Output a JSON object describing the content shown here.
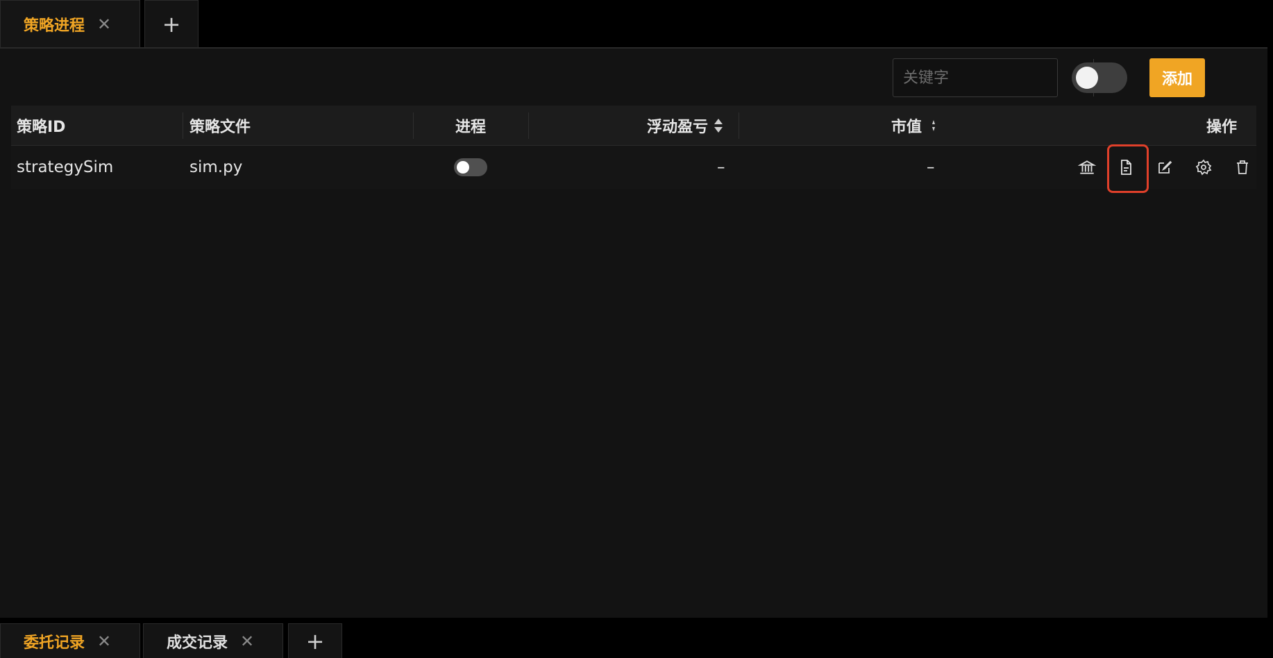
{
  "top_tabs": [
    {
      "label": "策略进程",
      "close": "✕"
    }
  ],
  "add_tab_symbol": "+",
  "toolbar": {
    "search_placeholder": "关键字",
    "add_label": "添加",
    "toggle_on": false
  },
  "table": {
    "headers": {
      "strategy_id": "策略ID",
      "strategy_file": "策略文件",
      "process": "进程",
      "floating_pnl": "浮动盈亏",
      "market_value": "市值",
      "operations": "操作"
    },
    "rows": [
      {
        "strategy_id": "strategySim",
        "strategy_file": "sim.py",
        "process_on": false,
        "floating_pnl": "–",
        "market_value": "–"
      }
    ],
    "row_actions": [
      "bank-icon",
      "document-icon",
      "edit-icon",
      "settings-icon",
      "trash-icon"
    ]
  },
  "bottom_tabs": [
    {
      "label": "委托记录",
      "close": "✕",
      "active": true
    },
    {
      "label": "成交记录",
      "close": "✕",
      "active": false
    }
  ],
  "colors": {
    "accent": "#f0a524",
    "highlight": "#e0402a",
    "background": "#131313"
  }
}
